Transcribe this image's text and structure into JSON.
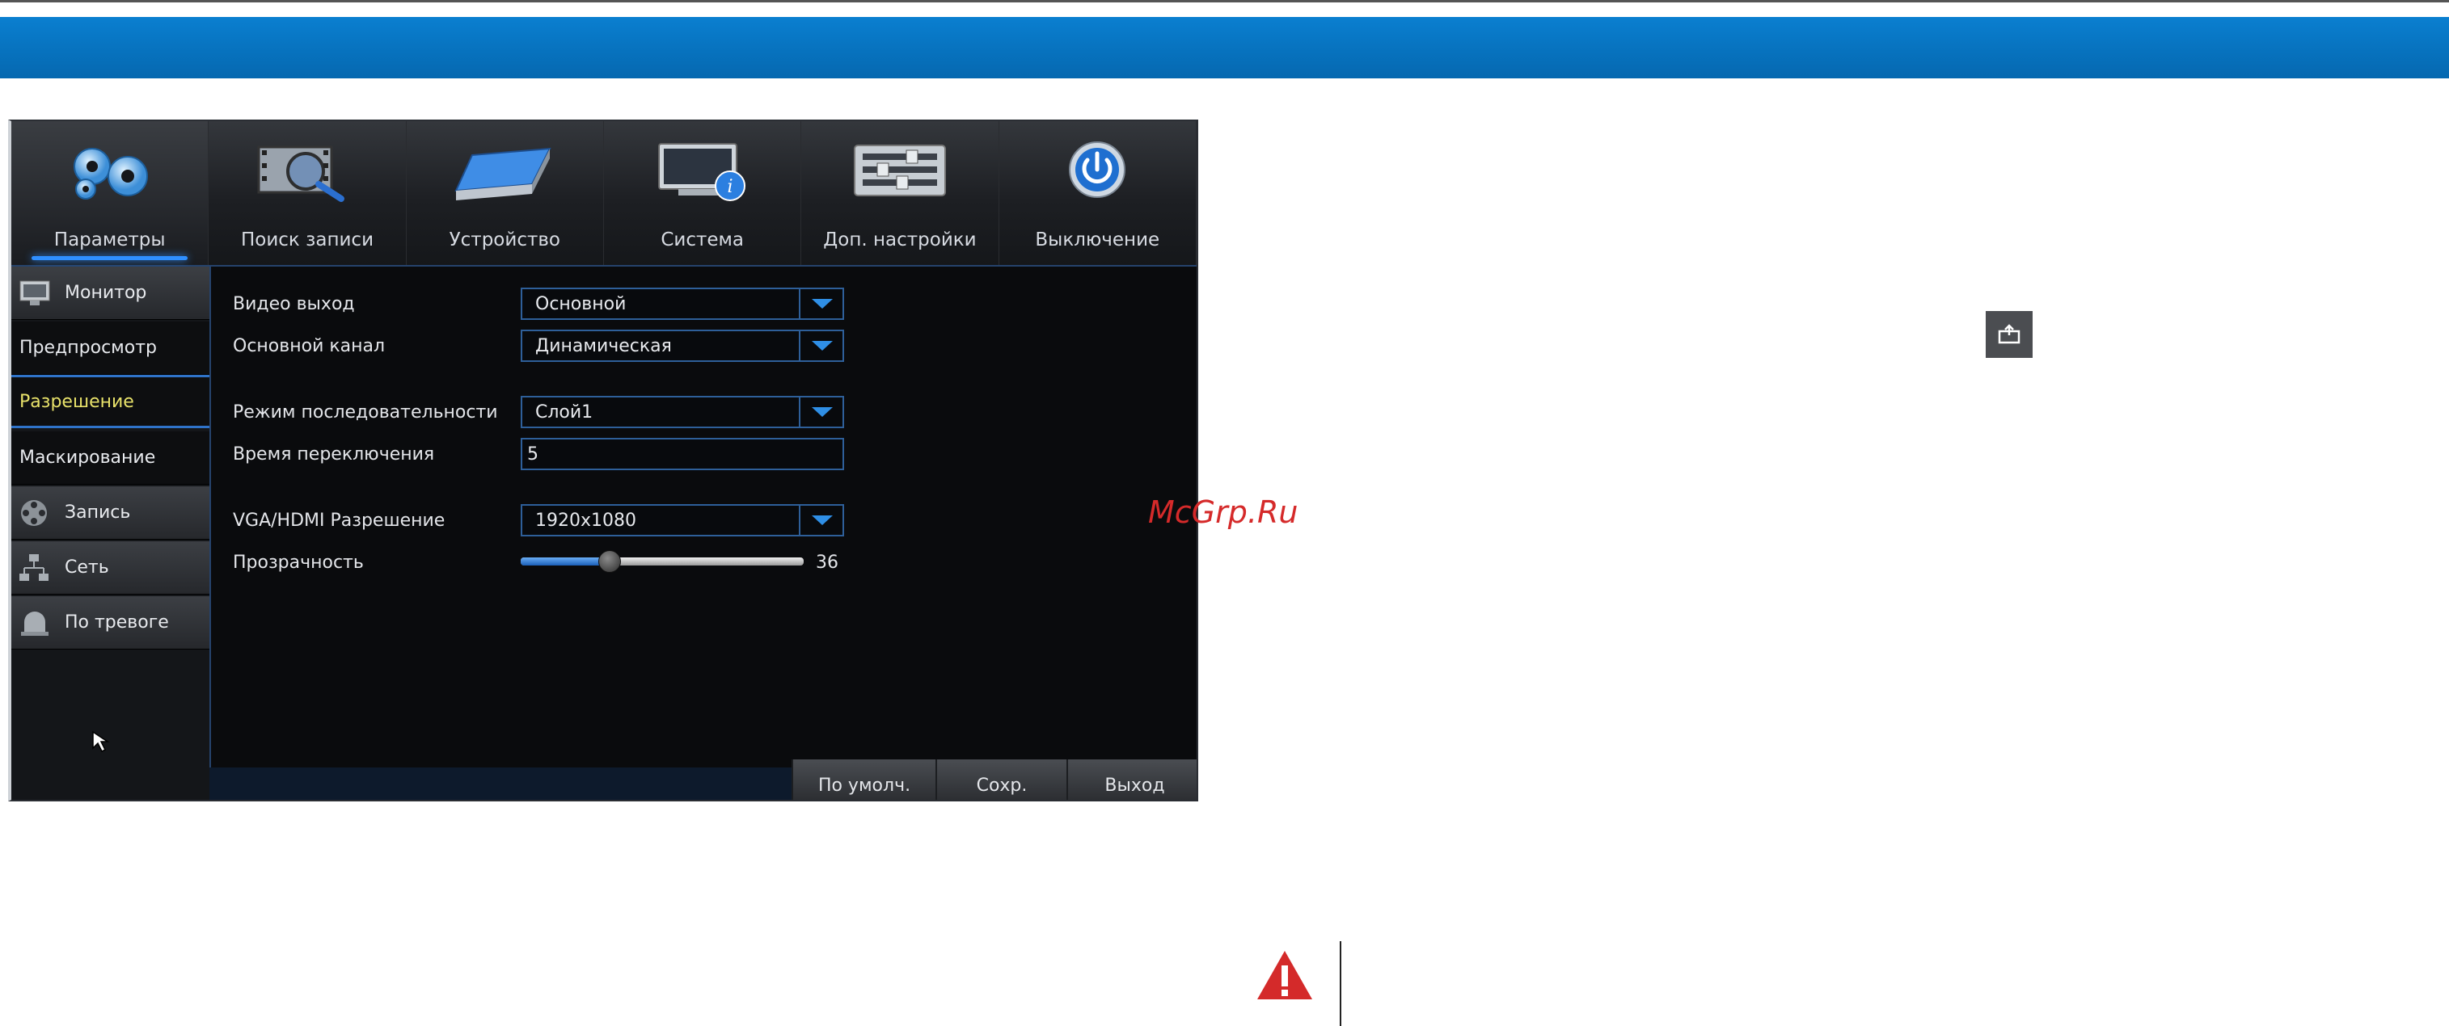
{
  "topnav": {
    "tabs": [
      {
        "label": "Параметры",
        "icon": "gears-icon",
        "active": true
      },
      {
        "label": "Поиск записи",
        "icon": "film-search-icon"
      },
      {
        "label": "Устройство",
        "icon": "hard-drive-icon"
      },
      {
        "label": "Система",
        "icon": "monitor-info-icon"
      },
      {
        "label": "Доп. настройки",
        "icon": "sliders-icon"
      },
      {
        "label": "Выключение",
        "icon": "power-icon"
      }
    ]
  },
  "sidebar": {
    "items": [
      {
        "label": "Монитор",
        "icon": "monitor-icon",
        "kind": "group"
      },
      {
        "label": "Предпросмотр",
        "kind": "sub"
      },
      {
        "label": "Разрешение",
        "kind": "sub",
        "selected": true
      },
      {
        "label": "Маскирование",
        "kind": "sub"
      },
      {
        "label": "Запись",
        "icon": "film-reel-icon",
        "kind": "group"
      },
      {
        "label": "Сеть",
        "icon": "network-icon",
        "kind": "group"
      },
      {
        "label": "По тревоге",
        "icon": "alarm-icon",
        "kind": "group"
      }
    ]
  },
  "form": {
    "video_out_label": "Видео выход",
    "video_out_value": "Основной",
    "main_channel_label": "Основной канал",
    "main_channel_value": "Динамическая",
    "sequence_mode_label": "Режим последовательности",
    "sequence_mode_value": "Слой1",
    "switch_time_label": "Время переключения",
    "switch_time_value": "5",
    "resolution_label": "VGA/HDMI Разрешение",
    "resolution_value": "1920x1080",
    "transparency_label": "Прозрачность",
    "transparency_value": "36",
    "transparency_fraction": 0.31
  },
  "buttons": {
    "default_label": "По умолч.",
    "save_label": "Сохр.",
    "exit_label": "Выход"
  },
  "watermark": "McGrp.Ru",
  "colors": {
    "banner": "#0672c0",
    "accent": "#2f8fff",
    "selected_text": "#e8e26a",
    "warning": "#d42a2a"
  }
}
